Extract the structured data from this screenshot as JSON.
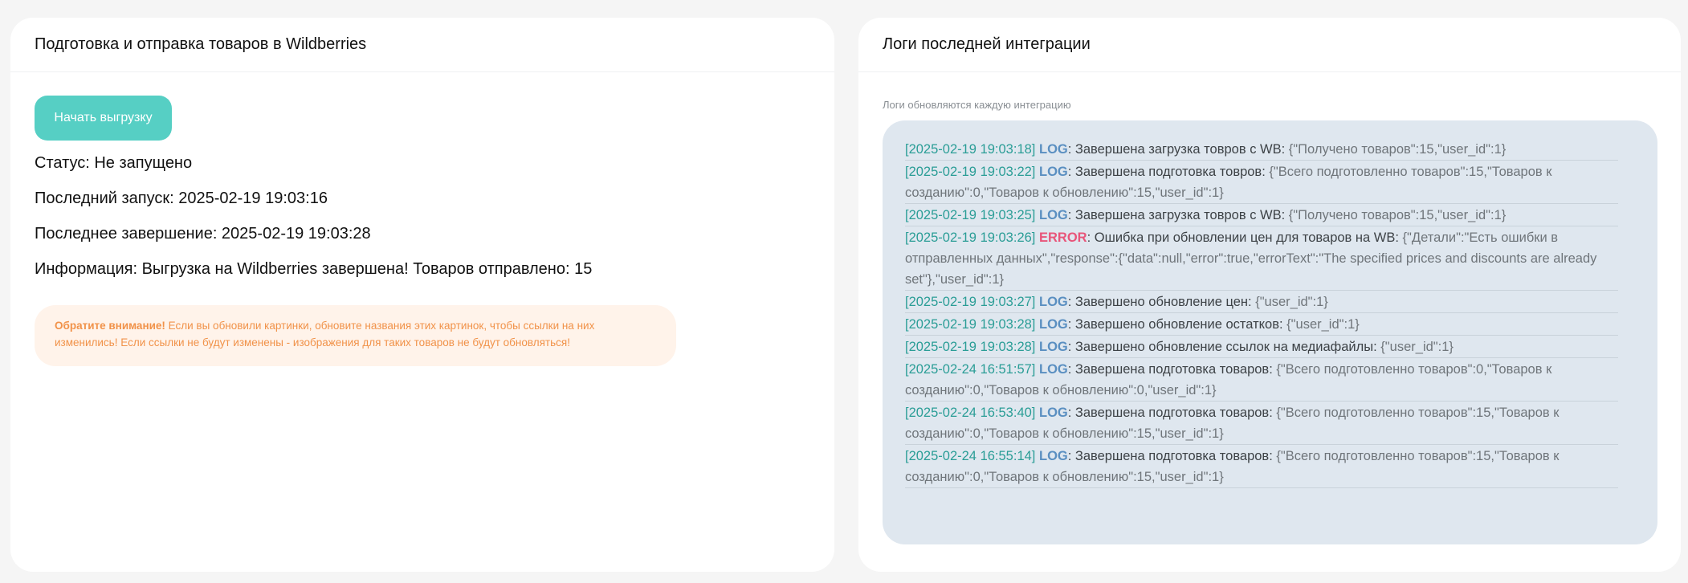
{
  "upload_card": {
    "title": "Подготовка и отправка товаров в Wildberries",
    "start_button": "Начать выгрузку",
    "status": "Статус: Не запущено",
    "last_start": "Последний запуск: 2025-02-19 19:03:16",
    "last_finish": "Последнее завершение: 2025-02-19 19:03:28",
    "info": "Информация: Выгрузка на Wildberries завершена! Товаров отправлено: 15",
    "warning_bold": "Обратите внимание!",
    "warning_text": " Если вы обновили картинки, обновите названия этих картинок, чтобы ссылки на них изменились! Если ссылки не будут изменены - изображения для таких товаров не будут обновляться!"
  },
  "logs_card": {
    "title": "Логи последней интеграции",
    "subtitle": "Логи обновляются каждую интеграцию",
    "entries": [
      {
        "ts": "[2025-02-19 19:03:18]",
        "level": "LOG",
        "msg": ": Завершена загрузка товров с WB: ",
        "json": "{\"Получено товаров\":15,\"user_id\":1}"
      },
      {
        "ts": "[2025-02-19 19:03:22]",
        "level": "LOG",
        "msg": ": Завершена подготовка товров: ",
        "json": "{\"Всего подготовленно товаров\":15,\"Товаров к созданию\":0,\"Товаров к обновлению\":15,\"user_id\":1}"
      },
      {
        "ts": "[2025-02-19 19:03:25]",
        "level": "LOG",
        "msg": ": Завершена загрузка товров с WB: ",
        "json": "{\"Получено товаров\":15,\"user_id\":1}"
      },
      {
        "ts": "[2025-02-19 19:03:26]",
        "level": "ERROR",
        "msg": ": Ошибка при обновлении цен для товаров на WB: ",
        "json": "{\"Детали\":\"Есть ошибки в отправленных данных\",\"response\":{\"data\":null,\"error\":true,\"errorText\":\"The specified prices and discounts are already set\"},\"user_id\":1}"
      },
      {
        "ts": "[2025-02-19 19:03:27]",
        "level": "LOG",
        "msg": ": Завершено обновление цен: ",
        "json": "{\"user_id\":1}"
      },
      {
        "ts": "[2025-02-19 19:03:28]",
        "level": "LOG",
        "msg": ": Завершено обновление остатков: ",
        "json": "{\"user_id\":1}"
      },
      {
        "ts": "[2025-02-19 19:03:28]",
        "level": "LOG",
        "msg": ": Завершено обновление ссылок на медиафайлы: ",
        "json": "{\"user_id\":1}"
      },
      {
        "ts": "[2025-02-24 16:51:57]",
        "level": "LOG",
        "msg": ": Завершена подготовка товаров: ",
        "json": "{\"Всего подготовленно товаров\":0,\"Товаров к созданию\":0,\"Товаров к обновлению\":0,\"user_id\":1}"
      },
      {
        "ts": "[2025-02-24 16:53:40]",
        "level": "LOG",
        "msg": ": Завершена подготовка товаров: ",
        "json": "{\"Всего подготовленно товаров\":15,\"Товаров к созданию\":0,\"Товаров к обновлению\":15,\"user_id\":1}"
      },
      {
        "ts": "[2025-02-24 16:55:14]",
        "level": "LOG",
        "msg": ": Завершена подготовка товаров: ",
        "json": "{\"Всего подготовленно товаров\":15,\"Товаров к созданию\":0,\"Товаров к обновлению\":15,\"user_id\":1}"
      }
    ]
  },
  "colors": {
    "accent": "#56cfc4",
    "warning_bg": "#fff3ea",
    "warning_text": "#f19249",
    "logs_bg": "#dfe7ef",
    "timestamp": "#2a9d96",
    "level_log": "#5a8fc1",
    "level_error": "#e8557a"
  }
}
